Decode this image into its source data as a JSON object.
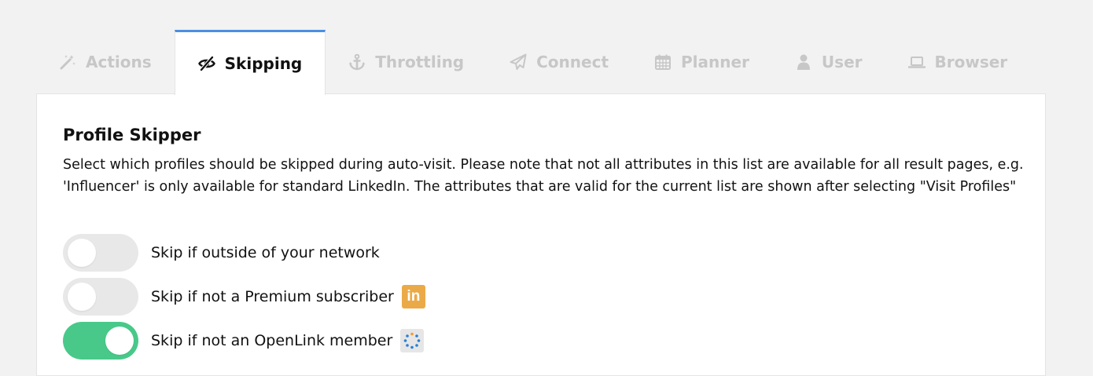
{
  "tabs": [
    {
      "label": "Actions",
      "icon": "magic-wand-icon",
      "active": false
    },
    {
      "label": "Skipping",
      "icon": "eye-slash-icon",
      "active": true
    },
    {
      "label": "Throttling",
      "icon": "anchor-icon",
      "active": false
    },
    {
      "label": "Connect",
      "icon": "paper-plane-icon",
      "active": false
    },
    {
      "label": "Planner",
      "icon": "calendar-icon",
      "active": false
    },
    {
      "label": "User",
      "icon": "user-icon",
      "active": false
    },
    {
      "label": "Browser",
      "icon": "laptop-icon",
      "active": false
    }
  ],
  "section": {
    "title": "Profile Skipper",
    "description": "Select which profiles should be skipped during auto-visit. Please note that not all attributes in this list are available for all result pages, e.g. 'Influencer' is only available for standard LinkedIn. The attributes that are valid for the current list are shown after selecting \"Visit Profiles\""
  },
  "options": [
    {
      "label": "Skip if outside of your network",
      "enabled": false,
      "badge": null
    },
    {
      "label": "Skip if not a Premium subscriber",
      "enabled": false,
      "badge": "linkedin-icon"
    },
    {
      "label": "Skip if not an OpenLink member",
      "enabled": true,
      "badge": "openlink-icon"
    }
  ],
  "colors": {
    "accent_tab": "#4a90e2",
    "toggle_on": "#48c98a",
    "toggle_off": "#e8e8e8",
    "linkedin_badge": "#ebaa48",
    "inactive_tab_text": "#c7c7c7"
  }
}
